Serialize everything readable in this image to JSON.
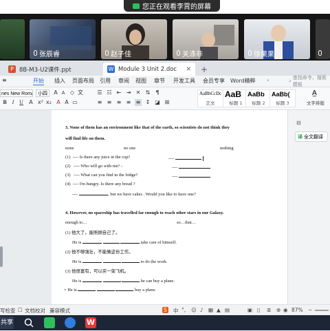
{
  "screen_share": {
    "banner_text": "您正在观看李霄的屏幕"
  },
  "participants": [
    {
      "name": "张辰睿"
    },
    {
      "name": "赵子佳"
    },
    {
      "name": "关涤非"
    },
    {
      "name": "徐果果"
    }
  ],
  "tabs": [
    {
      "label": "8B-M3-U2课件.ppt"
    },
    {
      "label": "Module 3 Unit 2.doc"
    }
  ],
  "menu": {
    "items": [
      "开始",
      "插入",
      "页面布局",
      "引用",
      "审阅",
      "视图",
      "章节",
      "开发工具",
      "会员专享",
      "Word精粹"
    ],
    "search_placeholder": "查找命令、搜索模板"
  },
  "ribbon": {
    "font_name": "nes New Roma",
    "font_size": "小四",
    "styles": [
      {
        "sample": "AaBbCcDc",
        "label": "正文"
      },
      {
        "sample": "AaB",
        "label": "标题 1"
      },
      {
        "sample": "AaBb",
        "label": "标题 2"
      },
      {
        "sample": "AaBb(",
        "label": "标题 3"
      }
    ],
    "text_layout_label": "文字排版"
  },
  "side_panel": {
    "translate_label": "全文翻译"
  },
  "document": {
    "q3": {
      "heading_line1": "3. None of them has an environment like that of the earth, so scientists do not think they",
      "heading_line2": "will find life on them.",
      "word_options": [
        "none",
        "no one",
        "nothing"
      ],
      "items": [
        {
          "num": "(1)",
          "text": "---- Is there any juice in the cup?",
          "answer_prefix": "----"
        },
        {
          "num": "(2)",
          "text": "---- Who will go with me? -",
          "answer_prefix": "----"
        },
        {
          "num": "(3)",
          "text": "---- What can you find in the fridge?",
          "answer_prefix": "----"
        },
        {
          "num": "(4)",
          "text": "---- I'm hungry. Is there any bread ?",
          "answer_prefix": ""
        }
      ],
      "item4_continuation": ", but we have cakes . Would you like to have one?",
      "item4_prefix": "----"
    },
    "q4": {
      "heading": "4.   However, no spaceship has travelled far enough to reach other stars in our Galaxy.",
      "word_options": [
        "enough     to…",
        "so…that…"
      ],
      "items": [
        {
          "num": "(1)",
          "chinese": "他大了，能照顾自己了。",
          "prefix": "He is",
          "suffix": "take care of himself."
        },
        {
          "num": "(2)",
          "chinese": "他不够强壮，不能做这份工作。",
          "prefix": "He is",
          "suffix": "to do the work."
        },
        {
          "num": "(3)",
          "chinese": "他很富有，可以买一架飞机。",
          "prefix": "He is",
          "suffix": "he can buy a plane."
        }
      ],
      "extra_line_prefix": "= He is",
      "extra_line_suffix": "buy a plane."
    }
  },
  "statusbar": {
    "spellcheck": "写检查",
    "proofread": "文档校对",
    "compat": "兼容模式",
    "zoom": "87%"
  },
  "colors": {
    "accent": "#2b6cd8",
    "taskbar": "#1d2636",
    "banner": "#2c2c2c"
  }
}
